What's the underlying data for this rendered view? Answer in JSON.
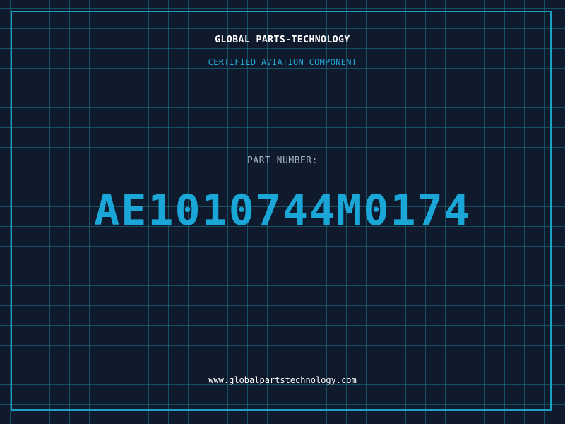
{
  "header": {
    "brand": "GLOBAL PARTS-TECHNOLOGY",
    "subtitle": "CERTIFIED AVIATION COMPONENT"
  },
  "part": {
    "label": "PART NUMBER:",
    "number": "AE1010744M0174"
  },
  "footer": {
    "website": "www.globalpartstechnology.com"
  },
  "colors": {
    "background": "#0f1a2d",
    "grid": "#1e788c",
    "frame": "#1f9fc4",
    "accent": "#1aa7d8",
    "text_primary": "#ffffff",
    "text_muted": "#9fb0c2"
  }
}
